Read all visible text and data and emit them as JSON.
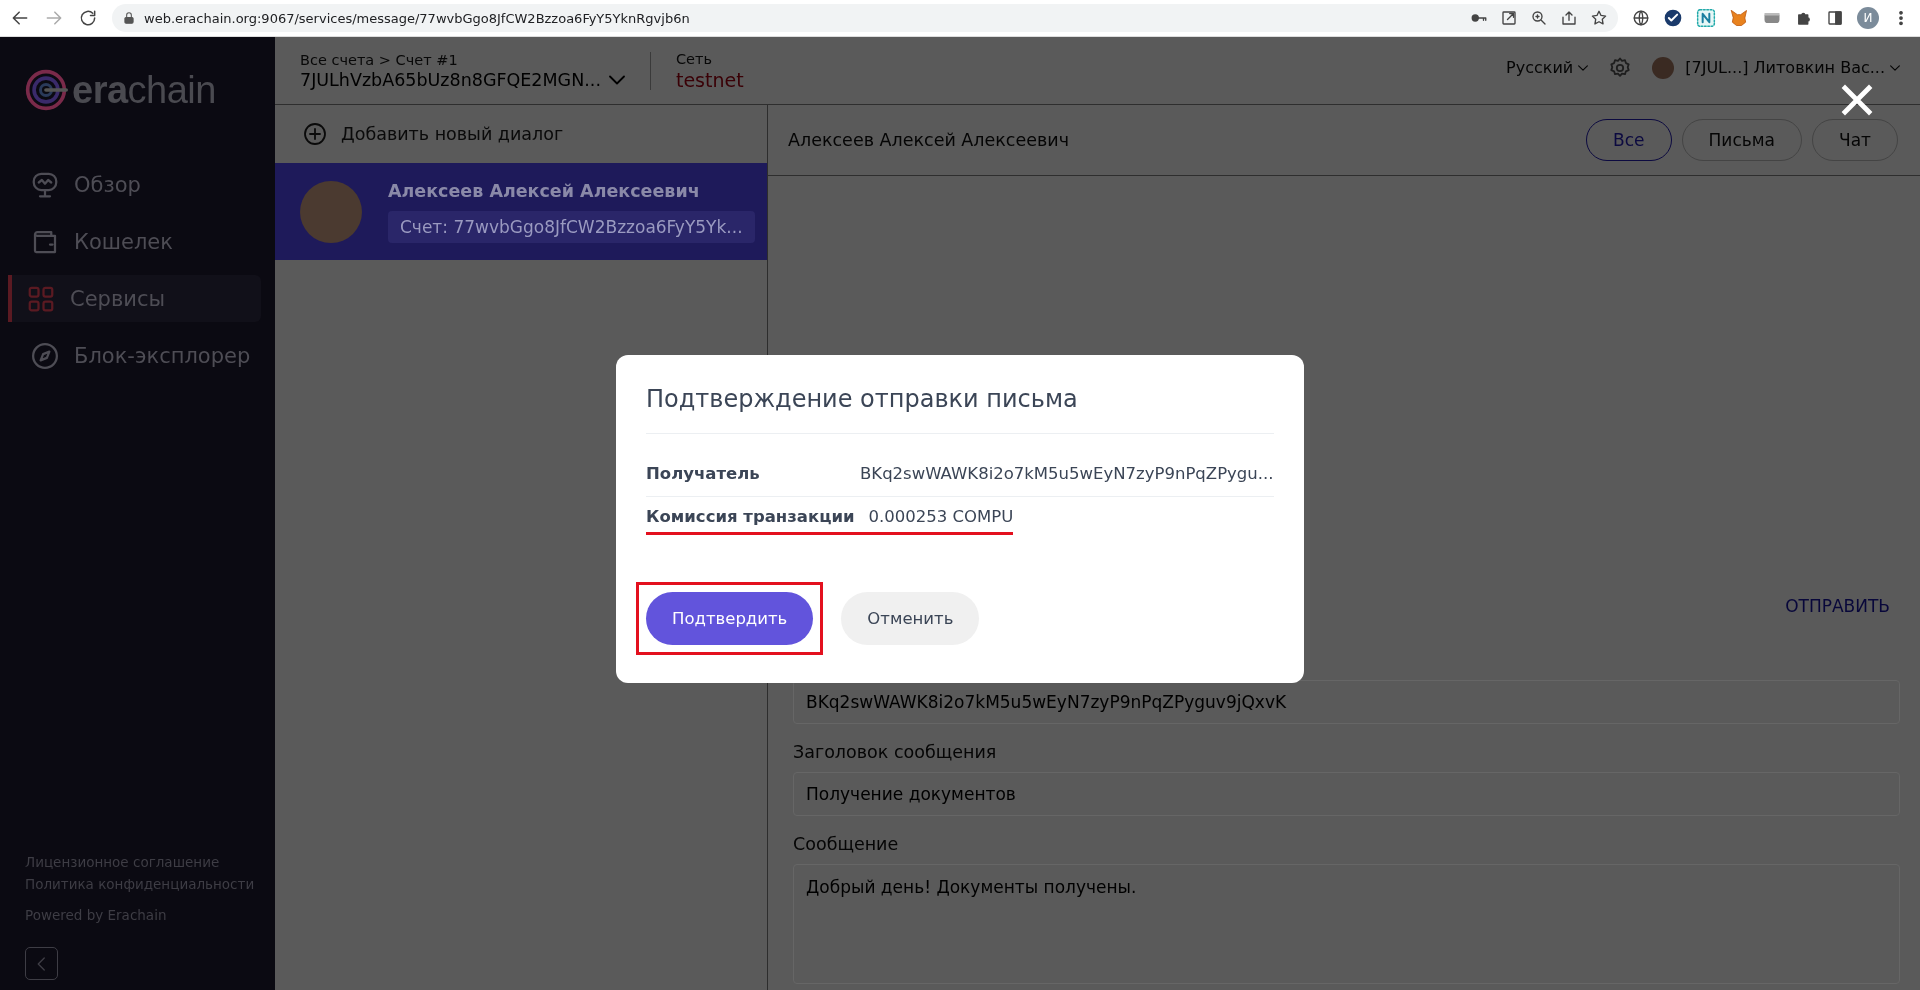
{
  "browser": {
    "url": "web.erachain.org:9067/services/message/77wvbGgo8JfCW2Bzzoa6FyY5YknRgvjb6n",
    "profile_initial": "И"
  },
  "sidebar": {
    "logo": "**era**chain",
    "items": [
      {
        "label": "Обзор",
        "kind": "monitor",
        "selected": false
      },
      {
        "label": "Кошелек",
        "kind": "wallet",
        "selected": false
      },
      {
        "label": "Сервисы",
        "kind": "grid",
        "selected": true
      },
      {
        "label": "Блок-эксплорер",
        "kind": "compass",
        "selected": false
      }
    ],
    "footer_links": [
      "Лицензионное соглашение",
      "Политика конфиденциальности"
    ],
    "powered": "Powered by Erachain"
  },
  "header": {
    "breadcrumb": "Все счета > Счет #1",
    "account": "7JULhVzbA65bUz8n8GFQE2MGN...",
    "network_label": "Сеть",
    "network": "testnet",
    "language": "Русский",
    "user": "[7JUL...] Литовкин Вас..."
  },
  "dialogs": {
    "add_label": "Добавить новый диалог",
    "items": [
      {
        "name": "Алексеев Алексей Алексеевич",
        "account": "Счет: 77wvbGgo8JfCW2Bzzoa6FyY5Yk...",
        "selected": true
      }
    ]
  },
  "chat": {
    "title": "Алексеев Алексей Алексеевич",
    "filters": [
      {
        "label": "Все",
        "selected": true
      },
      {
        "label": "Письма",
        "selected": false
      },
      {
        "label": "Чат",
        "selected": false
      }
    ],
    "send_label": "ОТПРАВИТЬ",
    "fields": [
      {
        "kind": "input",
        "value": "BKq2swWAWK8i2o7kM5u5wEyN7zyP9nPqZPyguv9jQxvK"
      },
      {
        "kind": "input",
        "label": "Заголовок сообщения",
        "value": "Получение документов"
      },
      {
        "kind": "textarea",
        "label": "Сообщение",
        "value": "Добрый день! Документы получены."
      }
    ]
  },
  "modal": {
    "title": "Подтверждение отправки письма",
    "rows": [
      {
        "label": "Получатель",
        "value": "BKq2swWAWK8i2o7kM5u5wEyN7zyP9nPqZPygu...",
        "highlighted": false
      },
      {
        "label": "Комиссия транзакции",
        "value": "0.000253 COMPU",
        "highlighted": true
      }
    ],
    "buttons": [
      {
        "label": "Подтвердить",
        "kind": "primary",
        "highlighted": true
      },
      {
        "label": "Отменить",
        "kind": "secondary",
        "highlighted": false
      }
    ]
  }
}
